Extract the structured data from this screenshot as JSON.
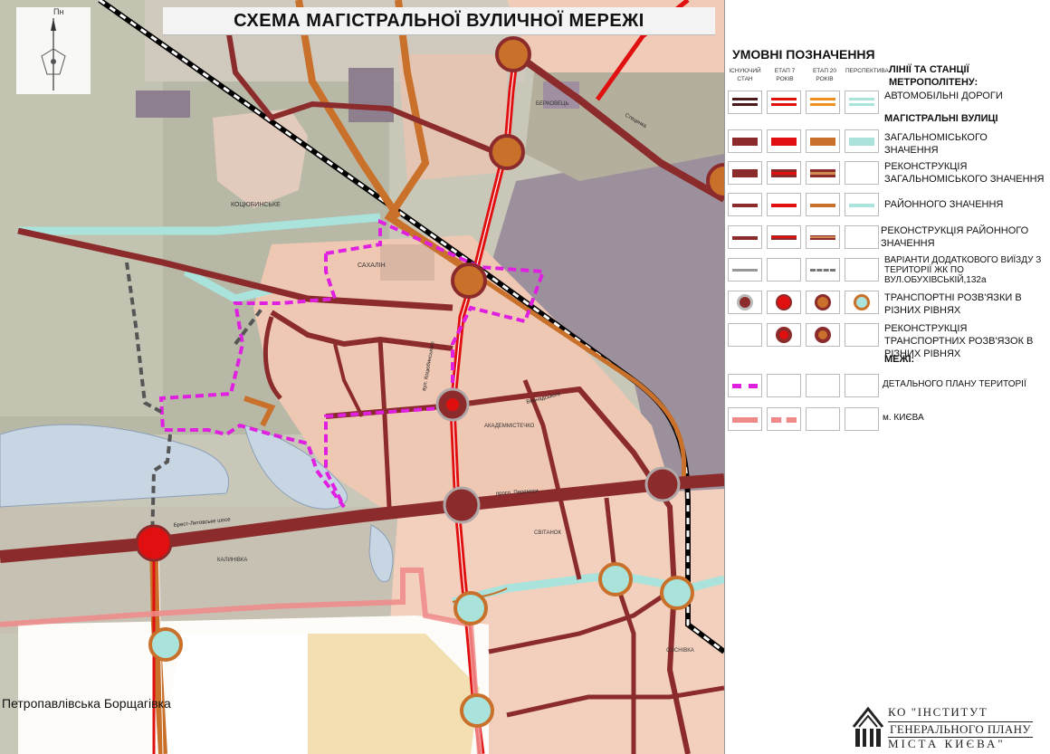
{
  "map": {
    "title": "СХЕМА МАГІСТРАЛЬНОЇ ВУЛИЧНОЇ МЕРЕЖІ",
    "north_label": "Пн",
    "places": {
      "kotsiubynske": "КОЦЮБИНСЬКЕ",
      "sakhaly": "САХАЛІН",
      "borshchahivka": "Петропавлівська Борщагівка",
      "akademmistechko": "АКАДЕММІСТЕЧКО",
      "svitanok": "СВІТАНОК",
      "kaluhivka": "КАЛИНІВКА",
      "berkovets": "БЕРКОВЕЦЬ",
      "sosnivka": "СОСНІВКА"
    },
    "streets": {
      "peremohy": "просп. Перемоги",
      "brest_lytovske": "Брест-Литовське шосе",
      "stetsenka": "Стеценка",
      "vernadskoho": "Вернадського",
      "kotsiubynskoho": "вул. Коцюбинського"
    },
    "colors": {
      "red": "#e01010",
      "maroon": "#8b2b2b",
      "orange": "#c9702a",
      "cyan": "#a9e3dc",
      "magenta": "#e020e0",
      "pink": "#f08a8a"
    }
  },
  "legend": {
    "title": "УМОВНІ ПОЗНАЧЕННЯ",
    "stages": {
      "existing": "ІСНУЮЧИЙ СТАН",
      "stage7": "ЕТАП 7 РОКІВ",
      "stage20": "ЕТАП 20 РОКІВ",
      "perspective": "ПЕРСПЕКТИВА"
    },
    "metro": "ЛІНІЇ ТА СТАНЦІЇ МЕТРОПОЛІТЕНУ:",
    "roads": "АВТОМОБІЛЬНІ ДОРОГИ",
    "main_streets": "МАГІСТРАЛЬНІ ВУЛИЦІ",
    "city_value": "ЗАГАЛЬНОМІСЬКОГО ЗНАЧЕННЯ",
    "recon_city": "РЕКОНСТРУКЦІЯ ЗАГАЛЬНОМІСЬКОГО ЗНАЧЕННЯ",
    "district": "РАЙОННОГО ЗНАЧЕННЯ",
    "recon_district": "РЕКОНСТРУКЦІЯ РАЙОННОГО ЗНАЧЕННЯ",
    "variants": "ВАРІАНТИ ДОДАТКОВОГО ВИЇЗДУ З ТЕРИТОРІЇ ЖК ПО ВУЛ.ОБУХІВСЬКІЙ,132а",
    "interchanges": "ТРАНСПОРТНІ РОЗВ'ЯЗКИ В РІЗНИХ РІВНЯХ",
    "recon_interchanges": "РЕКОНСТРУКЦІЯ ТРАНСПОРТНИХ РОЗВ'ЯЗОК В РІЗНИХ РІВНЯХ",
    "boundaries": "МЕЖІ:",
    "detail_plan": "ДЕТАЛЬНОГО ПЛАНУ ТЕРИТОРІЇ",
    "kyiv": "м. КИЄВА"
  },
  "logo": {
    "line1": "КО \"ІНСТИТУТ",
    "line2": "ГЕНЕРАЛЬНОГО ПЛАНУ",
    "line3": "МІСТА КИЄВА\""
  }
}
